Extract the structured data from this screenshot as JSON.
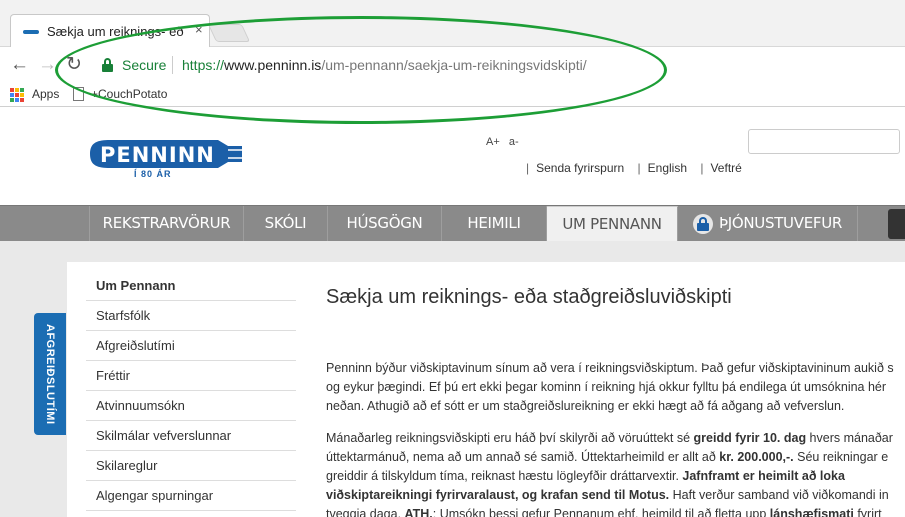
{
  "browser": {
    "tab_title": "Sækja um reiknings- eð",
    "tab_close": "×",
    "secure_label": "Secure",
    "url_scheme": "https://",
    "url_host": "www.penninn.is",
    "url_path": "/um-pennann/saekja-um-reikningsvidskipti/",
    "nav": {
      "back": "←",
      "forward": "→",
      "reload": "↻"
    },
    "bookmarks": [
      {
        "label": "Apps",
        "icon": "apps-grid-icon"
      },
      {
        "label": "+CouchPotato",
        "icon": "page-icon"
      }
    ],
    "apps_colors": [
      "#ea4335",
      "#fbbc05",
      "#34a853",
      "#4285f4",
      "#ea4335",
      "#fbbc05",
      "#34a853",
      "#4285f4",
      "#ea4335"
    ],
    "highlight_color": "#1d9e36"
  },
  "header": {
    "logo_text": "PENNINN",
    "logo_sub": "Í 80 ÁR",
    "font_increase": "A+",
    "font_decrease": "a-",
    "links": [
      "Senda fyrirspurn",
      "English",
      "Veftré"
    ],
    "link_separator": "|"
  },
  "nav": {
    "items": [
      "REKSTRARVÖRUR",
      "SKÓLI",
      "HÚSGÖGN",
      "HEIMILI",
      "UM PENNANN",
      "ÞJÓNUSTUVEFUR"
    ],
    "active": "UM PENNANN",
    "brand_color": "#1b6db3"
  },
  "sidebar": {
    "items": [
      "Um Pennann",
      "Starfsfólk",
      "Afgreiðslutími",
      "Fréttir",
      "Atvinnuumsókn",
      "Skilmálar vefverslunnar",
      "Skilareglur",
      "Algengar spurningar"
    ],
    "tab_label": "AFGREIÐSLUTÍMI"
  },
  "main": {
    "title": "Sækja um reiknings- eða staðgreiðsluviðskipti",
    "para1": [
      "Penninn býður viðskiptavinum sínum að vera í reikningsviðskiptum. Það gefur viðskiptavininum aukið s",
      "og eykur þægindi. Ef þú ert ekki þegar kominn í reikning hjá okkur fylltu þá endilega út umsóknina hér",
      "neðan.  Athugið að ef sótt er um staðgreiðslureikning er ekki hægt að fá aðgang að vefverslun."
    ],
    "para2": {
      "l1a": "Mánaðarleg reikningsviðskipti eru háð því skilyrði að vöruúttekt sé ",
      "l1b": "greidd fyrir 10. dag",
      "l1c": " hvers mánaðar",
      "l2a": "úttektarmánuð, nema að um annað sé samið. Úttektarheimild er allt að ",
      "l2b": "kr. 200.000,-.",
      "l2c": " Séu reikningar e",
      "l3a": "greiddir á tilskyldum tíma, reiknast hæstu lögleyfðir dráttarvextir. ",
      "l3b": "Jafnframt er heimilt að loka",
      "l4a": "viðskiptareikningi fyrirvaralaust, og krafan send til Motus.",
      "l4b": " Haft verður samband við viðkomandi in",
      "l5a": "tveggja daga. ",
      "l5b": "ATH.",
      "l5c": ": Umsókn þessi gefur Pennanum ehf. heimild til að fletta upp ",
      "l5d": "lánshæfismati",
      "l5e": " fyrirt"
    }
  }
}
